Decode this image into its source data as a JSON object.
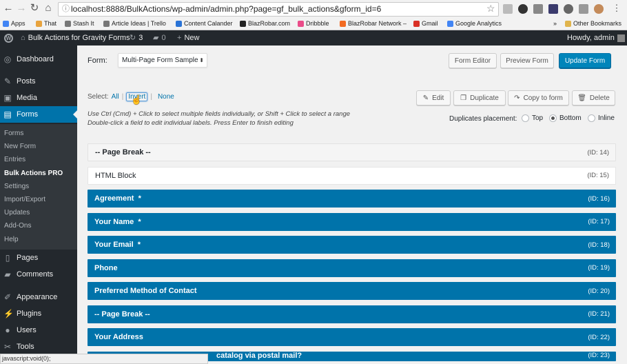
{
  "browser": {
    "url": "localhost:8888/BulkActions/wp-admin/admin.php?page=gf_bulk_actions&gform_id=6",
    "bookmarks": [
      {
        "label": "Apps",
        "icon": "apps-grid-icon",
        "color": "#4285f4"
      },
      {
        "label": "That",
        "icon": "globe-icon",
        "color": "#e8a33d"
      },
      {
        "label": "Stash It",
        "icon": "page-icon",
        "color": "#777777"
      },
      {
        "label": "Article Ideas | Trello",
        "icon": "page-icon",
        "color": "#777777"
      },
      {
        "label": "Content Calander",
        "icon": "calendar-icon",
        "color": "#2a73d6"
      },
      {
        "label": "BlazRobar.com",
        "icon": "b-logo-icon",
        "color": "#222222"
      },
      {
        "label": "Dribbble",
        "icon": "dribbble-icon",
        "color": "#ea4c89"
      },
      {
        "label": "BlazRobar Network –",
        "icon": "network-icon",
        "color": "#f26a21"
      },
      {
        "label": "Gmail",
        "icon": "gmail-icon",
        "color": "#d93025"
      },
      {
        "label": "Google Analytics",
        "icon": "google-icon",
        "color": "#4285f4"
      }
    ],
    "other_bookmarks": "Other Bookmarks",
    "overflow": "»",
    "status_text": "javascript:void(0);"
  },
  "adminbar": {
    "site_name": "Bulk Actions for Gravity Forms",
    "updates_count": "3",
    "comments_count": "0",
    "new_label": "New",
    "howdy": "Howdy, admin"
  },
  "sidebar": {
    "menu": [
      {
        "label": "Dashboard",
        "icon": "dashboard-icon",
        "glyph": "◎"
      },
      {
        "label": "Posts",
        "icon": "pin-icon",
        "glyph": "✎"
      },
      {
        "label": "Media",
        "icon": "media-icon",
        "glyph": "▣"
      },
      {
        "label": "Forms",
        "icon": "forms-icon",
        "glyph": "▤"
      },
      {
        "label": "Pages",
        "icon": "pages-icon",
        "glyph": "▯"
      },
      {
        "label": "Comments",
        "icon": "comment-icon",
        "glyph": "▰"
      },
      {
        "label": "Appearance",
        "icon": "appearance-icon",
        "glyph": "✐"
      },
      {
        "label": "Plugins",
        "icon": "plugin-icon",
        "glyph": "⚡"
      },
      {
        "label": "Users",
        "icon": "users-icon",
        "glyph": "●"
      },
      {
        "label": "Tools",
        "icon": "tools-icon",
        "glyph": "✂"
      }
    ],
    "submenu": [
      "Forms",
      "New Form",
      "Entries",
      "Bulk Actions PRO",
      "Settings",
      "Import/Export",
      "Updates",
      "Add-Ons",
      "Help"
    ]
  },
  "main": {
    "form_label": "Form:",
    "form_selected": "Multi-Page Form Sample",
    "buttons": {
      "form_editor": "Form Editor",
      "preview_form": "Preview Form",
      "update_form": "Update Form",
      "edit": "Edit",
      "duplicate": "Duplicate",
      "copy_to_form": "Copy to form",
      "delete": "Delete"
    },
    "select": {
      "label": "Select:",
      "all": "All",
      "invert": "Invert",
      "none": "None",
      "sep": "|"
    },
    "help_1": "Use Ctrl (Cmd) + Click to select multiple fields individually, or Shift + Click to select a range",
    "help_2": "Double-click a field to edit individual labels. Press Enter to finish editing",
    "placement": {
      "label": "Duplicates placement:",
      "options": [
        "Top",
        "Bottom",
        "Inline"
      ],
      "selected": "Bottom"
    },
    "fields": [
      {
        "label": "-- Page Break --",
        "id": "(ID: 14)",
        "state": "grey"
      },
      {
        "label": "HTML Block",
        "id": "(ID: 15)",
        "state": "plain"
      },
      {
        "label": "Agreement  *",
        "id": "(ID: 16)",
        "state": "selected"
      },
      {
        "label": "Your Name  *",
        "id": "(ID: 17)",
        "state": "selected"
      },
      {
        "label": "Your Email  *",
        "id": "(ID: 18)",
        "state": "selected"
      },
      {
        "label": "Phone",
        "id": "(ID: 19)",
        "state": "selected"
      },
      {
        "label": "Preferred Method of Contact",
        "id": "(ID: 20)",
        "state": "selected"
      },
      {
        "label": "-- Page Break --",
        "id": "(ID: 21)",
        "state": "selected"
      },
      {
        "label": "Your Address",
        "id": "(ID: 22)",
        "state": "selected"
      },
      {
        "label": "catalog via postal mail?",
        "id": "(ID: 23)",
        "state": "selected"
      }
    ]
  }
}
